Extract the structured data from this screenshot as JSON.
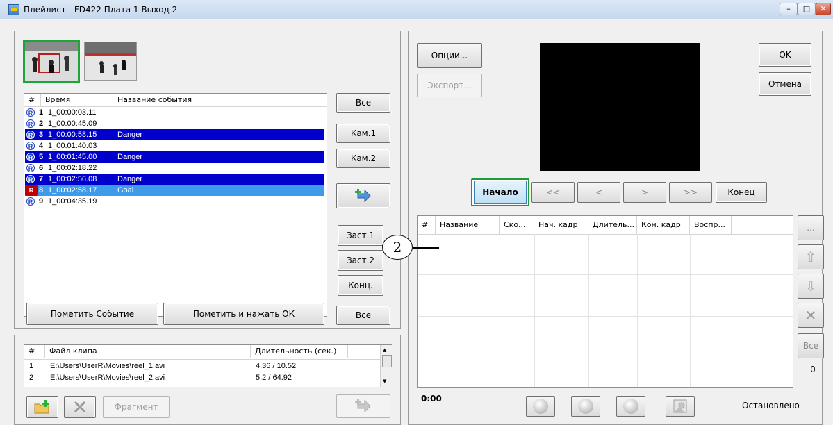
{
  "window": {
    "title": "Плейлист - FD422 Плата 1 Выход 2",
    "min": "–",
    "max": "□",
    "close": "✕"
  },
  "events": {
    "headers": {
      "num": "#",
      "time": "Время",
      "name": "Название события"
    },
    "rows": [
      {
        "num": "1",
        "time": "1_00:00:03.11",
        "name": "",
        "state": "normal"
      },
      {
        "num": "2",
        "time": "1_00:00:45.09",
        "name": "",
        "state": "normal"
      },
      {
        "num": "3",
        "time": "1_00:00:58.15",
        "name": "Danger",
        "state": "selected"
      },
      {
        "num": "4",
        "time": "1_00:01:40.03",
        "name": "",
        "state": "normal"
      },
      {
        "num": "5",
        "time": "1_00:01:45.00",
        "name": "Danger",
        "state": "selected"
      },
      {
        "num": "6",
        "time": "1_00:02:18.22",
        "name": "",
        "state": "normal"
      },
      {
        "num": "7",
        "time": "1_00:02:56.08",
        "name": "Danger",
        "state": "selected"
      },
      {
        "num": "8",
        "time": "1_00:02:58.17",
        "name": "Goal",
        "state": "current"
      },
      {
        "num": "9",
        "time": "1_00:04:35.19",
        "name": "",
        "state": "normal"
      }
    ],
    "badge_letter": "R"
  },
  "side_buttons": {
    "all_top": "Все",
    "cam1": "Кам.1",
    "cam2": "Кам.2",
    "zast1": "Заст.1",
    "zast2": "Заст.2",
    "konc": "Конц.",
    "all_bottom": "Все"
  },
  "mark_buttons": {
    "mark_event": "Пометить Событие",
    "mark_ok": "Пометить и нажать ОК"
  },
  "files": {
    "headers": {
      "num": "#",
      "file": "Файл клипа",
      "duration": "Длительность (сек.)"
    },
    "rows": [
      {
        "num": "1",
        "path": "E:\\Users\\UserR\\Movies\\reel_1.avi",
        "duration": "4.36 / 10.52"
      },
      {
        "num": "2",
        "path": "E:\\Users\\UserR\\Movies\\reel_2.avi",
        "duration": "5.2 / 64.92"
      }
    ],
    "fragment": "Фрагмент"
  },
  "right": {
    "options": "Опции...",
    "export": "Экспорт...",
    "ok": "OK",
    "cancel": "Отмена",
    "transport": {
      "start": "Начало",
      "back2": "<<",
      "back1": "<",
      "fwd1": ">",
      "fwd2": ">>",
      "end": "Конец"
    },
    "playlist_headers": {
      "num": "#",
      "name": "Название",
      "speed": "Ско...",
      "start_frame": "Нач. кадр",
      "duration": "Длитель...",
      "end_frame": "Кон. кадр",
      "play": "Воспр..."
    },
    "side": {
      "more": "...",
      "up": "⇧",
      "down": "⇩",
      "delete": "✕",
      "all": "Все",
      "count": "0"
    },
    "time": "0:00",
    "status": "Остановлено"
  },
  "callout": "2",
  "colors": {
    "selected": "#0000cc",
    "current": "#3d9be9",
    "highlight": "#1c9c3a"
  }
}
